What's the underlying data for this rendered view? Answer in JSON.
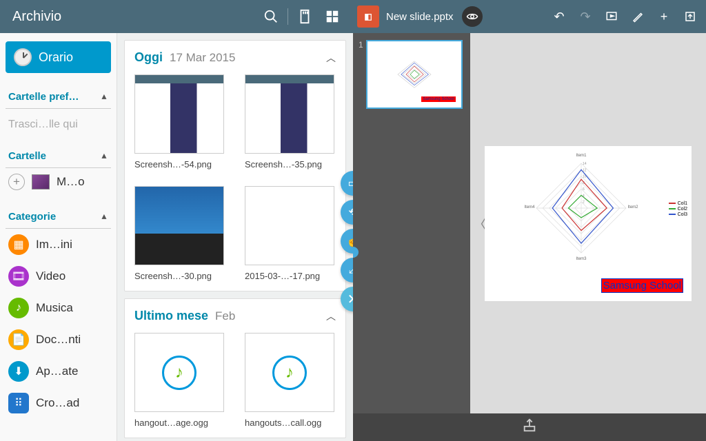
{
  "archive": {
    "title": "Archivio",
    "header_icons": [
      "search",
      "sdcard",
      "grid"
    ],
    "orario_label": "Orario",
    "sections": {
      "favorites": {
        "label": "Cartelle pref…",
        "drag_hint": "Trasci…lle qui"
      },
      "folders": {
        "label": "Cartelle",
        "items": [
          {
            "label": "M…o"
          }
        ]
      },
      "categories": {
        "label": "Categorie",
        "items": [
          {
            "label": "Im…ini",
            "color": "orange",
            "glyph": "▦"
          },
          {
            "label": "Video",
            "color": "purple",
            "glyph": "🎞"
          },
          {
            "label": "Musica",
            "color": "green",
            "glyph": "♪"
          },
          {
            "label": "Doc…nti",
            "color": "yellow",
            "glyph": "📄"
          },
          {
            "label": "Ap…ate",
            "color": "blue",
            "glyph": "⬇"
          },
          {
            "label": "Cro…ad",
            "color": "bluesq",
            "glyph": "⠿"
          }
        ]
      }
    },
    "groups": [
      {
        "name": "Oggi",
        "date": "17 Mar 2015",
        "files": [
          {
            "name": "Screensh…-54.png",
            "kind": "screenshot"
          },
          {
            "name": "Screensh…-35.png",
            "kind": "screenshot"
          },
          {
            "name": "Screensh…-30.png",
            "kind": "desktop"
          },
          {
            "name": "2015-03-…-17.png",
            "kind": "blank"
          }
        ]
      },
      {
        "name": "Ultimo mese",
        "date": "Feb",
        "files": [
          {
            "name": "hangout…age.ogg",
            "kind": "audio"
          },
          {
            "name": "hangouts…call.ogg",
            "kind": "audio"
          }
        ]
      }
    ],
    "fab_actions": [
      "window",
      "rotate",
      "touch",
      "expand",
      "close"
    ]
  },
  "presentation": {
    "doc_title": "New slide.pptx",
    "toolbar": [
      "undo",
      "redo",
      "play",
      "draw",
      "add",
      "export"
    ],
    "slide_number": "1",
    "banner_text": "Samsung School",
    "legend": [
      "Col1",
      "Col2",
      "Col3"
    ],
    "axis_labels": [
      "Item1",
      "Item2",
      "Item3",
      "Item4"
    ]
  },
  "chart_data": {
    "type": "radar",
    "title": "",
    "categories": [
      "Item1",
      "Item2",
      "Item3",
      "Item4"
    ],
    "axis_ticks": [
      2,
      4,
      6,
      8,
      10,
      12,
      14
    ],
    "max": 14,
    "series": [
      {
        "name": "Col1",
        "color": "#cc3333",
        "values": [
          9,
          8,
          7,
          6
        ]
      },
      {
        "name": "Col2",
        "color": "#33aa33",
        "values": [
          4,
          5,
          3,
          4
        ]
      },
      {
        "name": "Col3",
        "color": "#3355cc",
        "values": [
          12,
          10,
          11,
          9
        ]
      }
    ]
  }
}
